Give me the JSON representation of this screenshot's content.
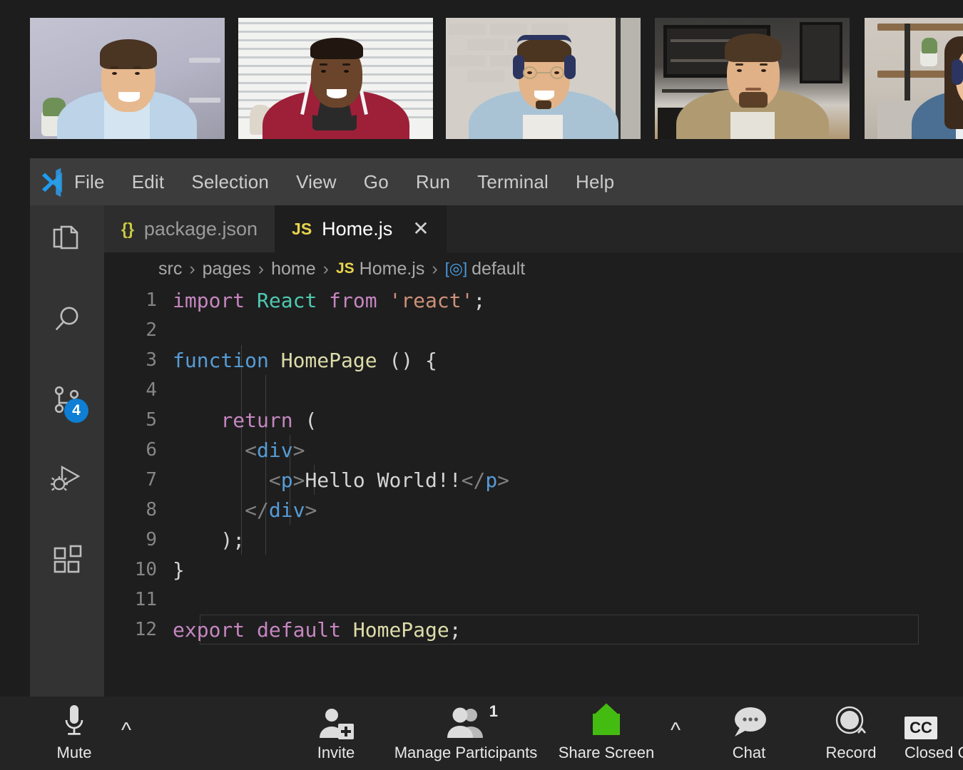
{
  "filmstrip": {
    "tiles": [
      {
        "name": "participant-tile-1",
        "desc": "man in light blue shirt, lavender wall with plant"
      },
      {
        "name": "participant-tile-2",
        "desc": "man in red polo shirt, window blinds background"
      },
      {
        "name": "participant-tile-3",
        "desc": "man with headphones and glasses, white brick wall"
      },
      {
        "name": "participant-tile-4",
        "desc": "man in tan jacket, kitchen background"
      },
      {
        "name": "participant-tile-5",
        "desc": "woman with headphones in denim shirt, shelves background"
      }
    ]
  },
  "vscode": {
    "menu": [
      "File",
      "Edit",
      "Selection",
      "View",
      "Go",
      "Run",
      "Terminal",
      "Help"
    ],
    "activity_bar": [
      {
        "icon": "explorer-files-icon",
        "label": "Explorer",
        "badge": ""
      },
      {
        "icon": "search-icon",
        "label": "Search",
        "badge": ""
      },
      {
        "icon": "source-control-branch-icon",
        "label": "Source Control",
        "badge": "4"
      },
      {
        "icon": "run-and-debug-icon",
        "label": "Run and Debug",
        "badge": ""
      },
      {
        "icon": "extensions-blocks-icon",
        "label": "Extensions",
        "badge": ""
      }
    ],
    "tabs": [
      {
        "icon": "{}",
        "label": "package.json",
        "active": false,
        "close": ""
      },
      {
        "icon": "JS",
        "label": "Home.js",
        "active": true,
        "close": "✕"
      }
    ],
    "breadcrumb": {
      "parts": [
        "src",
        "pages",
        "home"
      ],
      "sep": "›",
      "file_icon": "JS",
      "file": "Home.js",
      "symbol_icon": "[◎]",
      "symbol": "default"
    },
    "code": {
      "lines": [
        {
          "n": "1",
          "tokens": [
            {
              "t": "import ",
              "c": "t-kw"
            },
            {
              "t": "React ",
              "c": "t-cls"
            },
            {
              "t": "from ",
              "c": "t-kw"
            },
            {
              "t": "'react'",
              "c": "t-str"
            },
            {
              "t": ";",
              "c": "t-plain"
            }
          ]
        },
        {
          "n": "2",
          "tokens": []
        },
        {
          "n": "3",
          "tokens": [
            {
              "t": "function ",
              "c": "t-blue"
            },
            {
              "t": "HomePage ",
              "c": "t-fn"
            },
            {
              "t": "() {",
              "c": "t-plain"
            }
          ]
        },
        {
          "n": "4",
          "tokens": []
        },
        {
          "n": "5",
          "tokens": [
            {
              "t": "    ",
              "c": "t-plain"
            },
            {
              "t": "return",
              "c": "t-kw"
            },
            {
              "t": " (",
              "c": "t-plain"
            }
          ]
        },
        {
          "n": "6",
          "tokens": [
            {
              "t": "      ",
              "c": "t-plain"
            },
            {
              "t": "<",
              "c": "t-punct"
            },
            {
              "t": "div",
              "c": "t-tag"
            },
            {
              "t": ">",
              "c": "t-punct"
            }
          ]
        },
        {
          "n": "7",
          "tokens": [
            {
              "t": "        ",
              "c": "t-plain"
            },
            {
              "t": "<",
              "c": "t-punct"
            },
            {
              "t": "p",
              "c": "t-tag"
            },
            {
              "t": ">",
              "c": "t-punct"
            },
            {
              "t": "Hello World!!",
              "c": "t-txt"
            },
            {
              "t": "</",
              "c": "t-punct"
            },
            {
              "t": "p",
              "c": "t-tag"
            },
            {
              "t": ">",
              "c": "t-punct"
            }
          ]
        },
        {
          "n": "8",
          "tokens": [
            {
              "t": "      ",
              "c": "t-plain"
            },
            {
              "t": "</",
              "c": "t-punct"
            },
            {
              "t": "div",
              "c": "t-tag"
            },
            {
              "t": ">",
              "c": "t-punct"
            }
          ]
        },
        {
          "n": "9",
          "tokens": [
            {
              "t": "    );",
              "c": "t-plain"
            }
          ]
        },
        {
          "n": "10",
          "tokens": [
            {
              "t": "}",
              "c": "t-plain"
            }
          ]
        },
        {
          "n": "11",
          "tokens": []
        },
        {
          "n": "12",
          "tokens": [
            {
              "t": "export ",
              "c": "t-kw"
            },
            {
              "t": "default ",
              "c": "t-kw"
            },
            {
              "t": "HomePage",
              "c": "t-fn"
            },
            {
              "t": ";",
              "c": "t-plain"
            }
          ],
          "current": true
        }
      ]
    }
  },
  "zoom_toolbar": {
    "buttons": [
      {
        "name": "mute-button",
        "icon": "microphone-icon",
        "label": "Mute",
        "chevron": true,
        "badge": ""
      },
      {
        "name": "invite-button",
        "icon": "add-person-icon",
        "label": "Invite",
        "chevron": false,
        "badge": ""
      },
      {
        "name": "manage-participants-button",
        "icon": "participants-icon",
        "label": "Manage Participants",
        "chevron": false,
        "badge": "1"
      },
      {
        "name": "share-screen-button",
        "icon": "share-screen-up-arrow-icon",
        "label": "Share Screen",
        "chevron": true,
        "badge": ""
      },
      {
        "name": "chat-button",
        "icon": "chat-bubble-icon",
        "label": "Chat",
        "chevron": false,
        "badge": ""
      },
      {
        "name": "record-button",
        "icon": "record-circle-icon",
        "label": "Record",
        "chevron": false,
        "badge": ""
      },
      {
        "name": "closed-caption-button",
        "icon": "cc-icon",
        "label": "Closed C",
        "chevron": false,
        "badge": "",
        "cc_text": "CC"
      }
    ]
  },
  "colors": {
    "zoom_share_green": "#44bb11",
    "vscode_blue": "#0e7fd4",
    "editor_bg": "#1e1e1e",
    "activitybar_bg": "#333333",
    "menubar_bg": "#3c3c3c",
    "toolbar_bg": "#242424"
  }
}
